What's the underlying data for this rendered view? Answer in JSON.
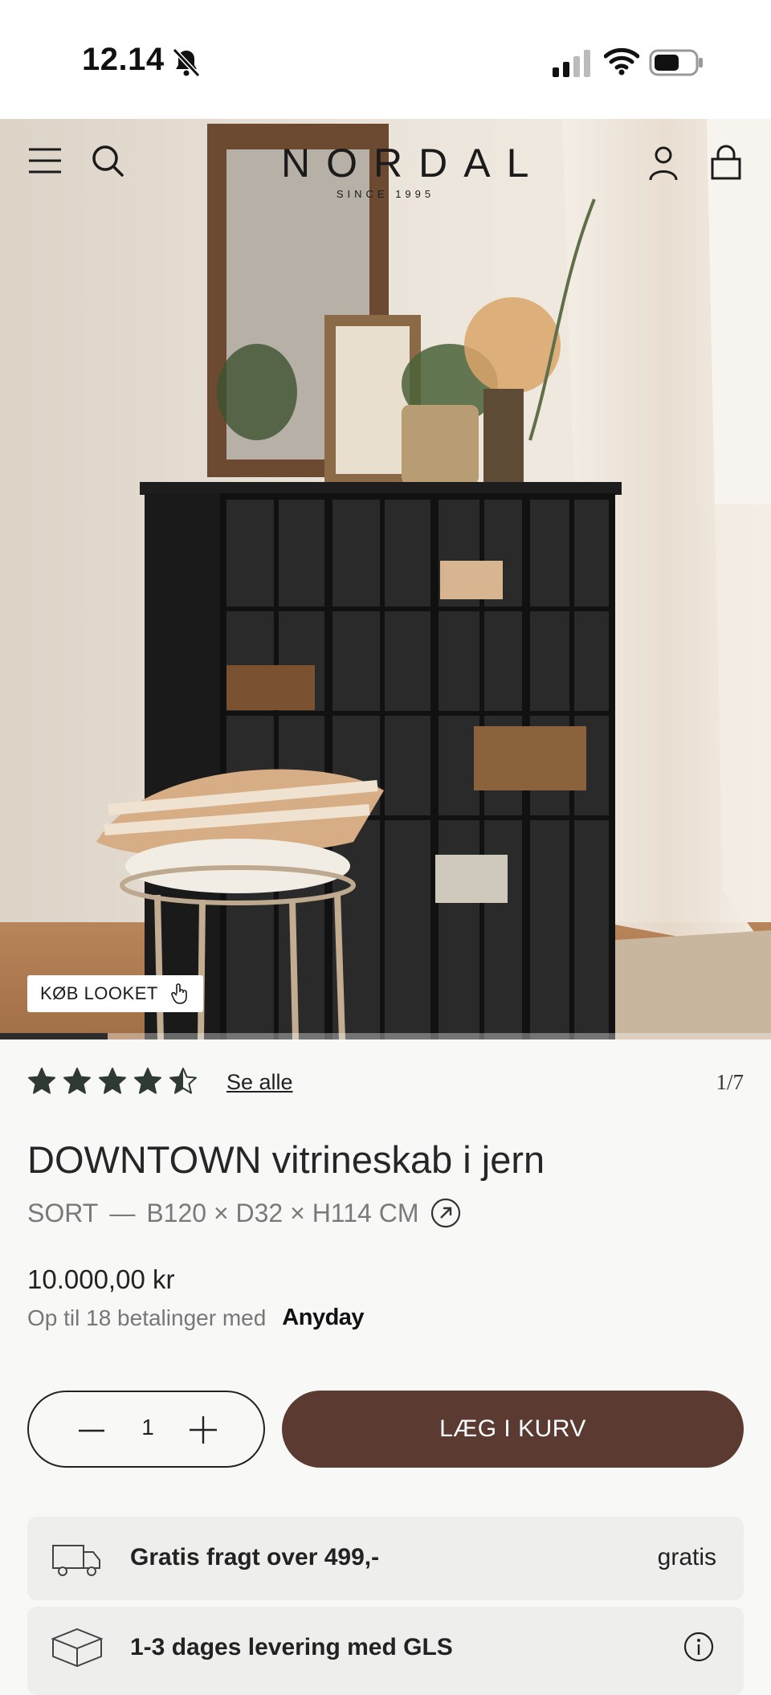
{
  "status_bar": {
    "time": "12.14"
  },
  "header": {
    "brand": "NORDAL",
    "since": "SINCE 1995"
  },
  "hero": {
    "shop_look_label": "KØB LOOKET",
    "carousel_progress": 0.14
  },
  "product": {
    "rating": 4.5,
    "see_all_label": "Se alle",
    "image_counter": "1/7",
    "title": "DOWNTOWN vitrineskab i jern",
    "color": "SORT",
    "separator": "—",
    "dimensions": "B120 × D32 × H114 CM",
    "price": "10.000,00 kr",
    "installments_text": "Op til 18 betalinger med",
    "installments_provider": "Anyday"
  },
  "cart": {
    "quantity": "1",
    "add_to_cart_label": "LÆG I KURV"
  },
  "info": [
    {
      "icon": "truck-icon",
      "text": "Gratis fragt over 499,-",
      "right": "gratis"
    },
    {
      "icon": "box-icon",
      "text": "1-3 dages levering med GLS",
      "right_icon": "info-icon"
    }
  ],
  "colors": {
    "accent": "#5b3a32",
    "text": "#2b2b2b",
    "star": "#2f3a33"
  }
}
